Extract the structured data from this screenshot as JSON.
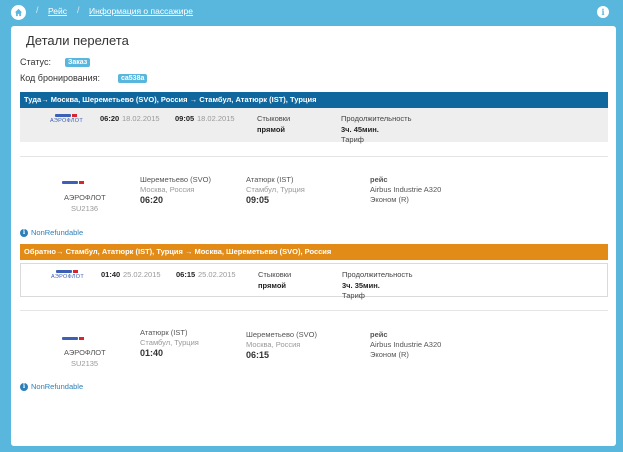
{
  "breadcrumb": {
    "items": [
      "Рейс",
      "Информация о пассажире"
    ],
    "separator": "/"
  },
  "page": {
    "title": "Детали перелета",
    "status_label": "Статус:",
    "status_value": "Заказ",
    "booking_label": "Код бронирования:",
    "booking_value": "ca538a"
  },
  "legs": [
    {
      "header": "Туда→ Москва, Шереметьево (SVO), Россия → Стамбул, Ататюрк (IST), Турция",
      "summary": {
        "airline_logo": "АЭРОФЛОТ",
        "dep_time": "06:20",
        "dep_date": "18.02.2015",
        "arr_time": "09:05",
        "arr_date": "18.02.2015",
        "stops_label": "Стыковки",
        "stops_value": "прямой",
        "duration_label": "Продолжительность",
        "duration_value": "3ч. 45мин.",
        "fare_label": "Тариф"
      },
      "segment": {
        "airline": "АЭРОФЛОТ",
        "flight": "SU2136",
        "from_airport": "Шереметьево (SVO)",
        "from_city": "Москва, Россия",
        "from_time": "06:20",
        "to_airport": "Ататюрк (IST)",
        "to_city": "Стамбул, Турция",
        "to_time": "09:05",
        "flight_label": "рейс",
        "aircraft": "Airbus Industrie A320",
        "cabin": "Эконом (R)"
      },
      "refund": "NonRefundable"
    },
    {
      "header": "Обратно→ Стамбул, Ататюрк (IST), Турция → Москва, Шереметьево (SVO), Россия",
      "summary": {
        "airline_logo": "АЭРОФЛОТ",
        "dep_time": "01:40",
        "dep_date": "25.02.2015",
        "arr_time": "06:15",
        "arr_date": "25.02.2015",
        "stops_label": "Стыковки",
        "stops_value": "прямой",
        "duration_label": "Продолжительность",
        "duration_value": "3ч. 35мин.",
        "fare_label": "Тариф"
      },
      "segment": {
        "airline": "АЭРОФЛОТ",
        "flight": "SU2135",
        "from_airport": "Ататюрк (IST)",
        "from_city": "Стамбул, Турция",
        "from_time": "01:40",
        "to_airport": "Шереметьево (SVO)",
        "to_city": "Москва, Россия",
        "to_time": "06:15",
        "flight_label": "рейс",
        "aircraft": "Airbus Industrie A320",
        "cabin": "Эконом (R)"
      },
      "refund": "NonRefundable"
    }
  ],
  "colors": {
    "background": "#59b6dd",
    "outbound_header": "#10679e",
    "return_header": "#e28c17",
    "badge": "#59b6dd",
    "link": "#2c7fb8"
  },
  "icons": [
    "home-icon",
    "info-icon",
    "aeroflot-logo"
  ]
}
